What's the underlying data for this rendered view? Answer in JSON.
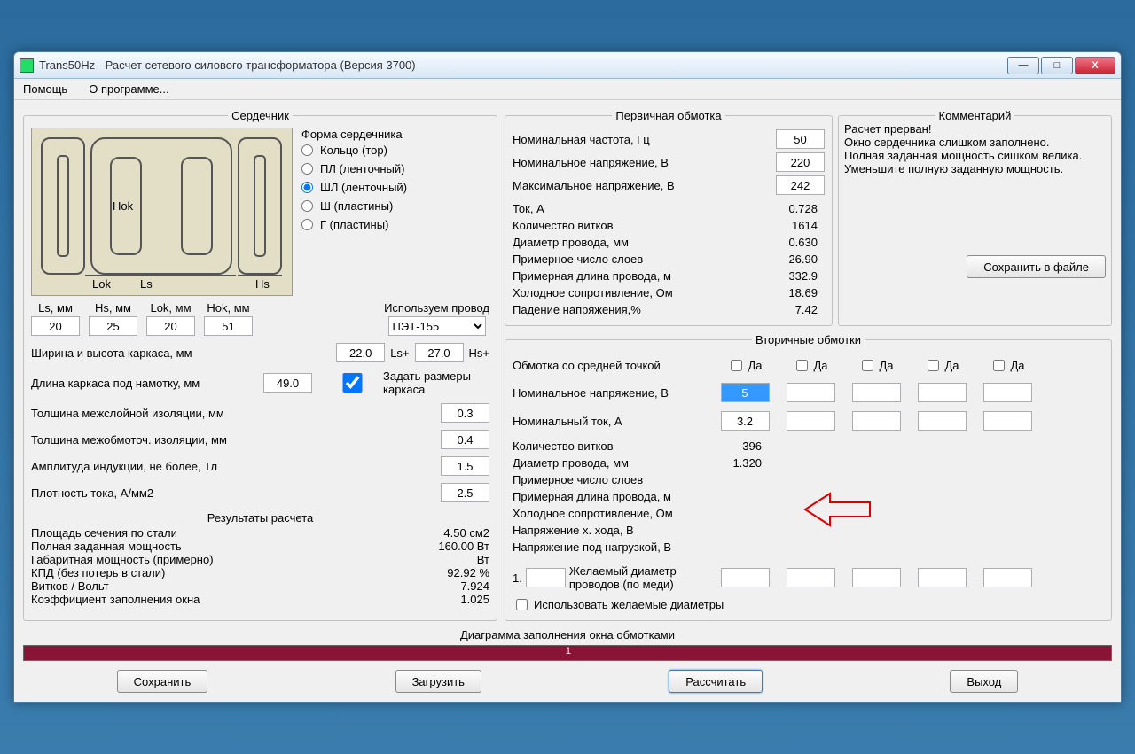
{
  "window_title": "Trans50Hz - Расчет сетевого силового трансформатора (Версия 3700)",
  "menu": {
    "help": "Помощь",
    "about": "О программе..."
  },
  "core": {
    "legend": "Сердечник",
    "form_label": "Форма сердечника",
    "forms": [
      {
        "label": "Кольцо (тор)",
        "sel": false
      },
      {
        "label": "ПЛ (ленточный)",
        "sel": false
      },
      {
        "label": "ШЛ (ленточный)",
        "sel": true
      },
      {
        "label": "Ш  (пластины)",
        "sel": false
      },
      {
        "label": "Г (пластины)",
        "sel": false
      }
    ],
    "diagram_labels": {
      "hok": "Hok",
      "lok": "Lok",
      "ls": "Ls",
      "hs": "Hs"
    },
    "dims": {
      "ls": {
        "label": "Ls, мм",
        "val": "20"
      },
      "hs": {
        "label": "Hs, мм",
        "val": "25"
      },
      "lok": {
        "label": "Lok, мм",
        "val": "20"
      },
      "hok": {
        "label": "Hok, мм",
        "val": "51"
      }
    },
    "wire_label": "Используем провод",
    "wire_value": "ПЭТ-155",
    "params": {
      "frame_wh": {
        "label": "Ширина и высота каркаса, мм",
        "v1": "22.0",
        "suf1": "Ls+",
        "v2": "27.0",
        "suf2": "Hs+"
      },
      "frame_len": {
        "label": "Длина каркаса под намотку, мм",
        "val": "49.0"
      },
      "set_frame": {
        "label": "Задать размеры каркаса",
        "checked": true
      },
      "interlayer": {
        "label": "Толщина межслойной изоляции, мм",
        "val": "0.3"
      },
      "interwind": {
        "label": "Толщина межобмоточ. изоляции, мм",
        "val": "0.4"
      },
      "induction": {
        "label": "Амплитуда индукции, не более, Тл",
        "val": "1.5"
      },
      "j": {
        "label": "Плотность тока, А/мм2",
        "val": "2.5"
      }
    },
    "results_title": "Результаты расчета",
    "results": [
      {
        "l": "Площадь сечения по стали",
        "v": "4.50 см2"
      },
      {
        "l": "Полная заданная мощность",
        "v": "160.00 Вт"
      },
      {
        "l": "Габаритная мощность (примерно)",
        "v": "Вт"
      },
      {
        "l": "КПД (без потерь в стали)",
        "v": "92.92 %"
      },
      {
        "l": "Витков / Вольт",
        "v": "7.924"
      },
      {
        "l": "Коэффициент заполнения окна",
        "v": "1.025"
      }
    ]
  },
  "primary": {
    "legend": "Первичная обмотка",
    "rows_in": [
      {
        "l": "Номинальная частота, Гц",
        "v": "50"
      },
      {
        "l": "Номинальное напряжение, В",
        "v": "220"
      },
      {
        "l": "Максимальное напряжение, В",
        "v": "242"
      }
    ],
    "rows_out": [
      {
        "l": "Ток, А",
        "v": "0.728"
      },
      {
        "l": "Количество витков",
        "v": "1614"
      },
      {
        "l": "Диаметр провода, мм",
        "v": "0.630"
      },
      {
        "l": "Примерное число слоев",
        "v": "26.90"
      },
      {
        "l": "Примерная длина провода, м",
        "v": "332.9"
      },
      {
        "l": "Холодное сопротивление, Ом",
        "v": "18.69"
      },
      {
        "l": "Падение напряжения,%",
        "v": "7.42"
      }
    ]
  },
  "comment": {
    "legend": "Комментарий",
    "text": "Расчет прерван!\nОкно сердечника слишком заполнено.\nПолная заданная мощность сишком велика.\nУменьшите полную заданную мощность.",
    "save_btn": "Сохранить в файле"
  },
  "secondary": {
    "legend": "Вторичные обмотки",
    "midtap": "Обмотка со средней точкой",
    "da": "Да",
    "nom_v": {
      "label": "Номинальное напряжение, В",
      "val": "5"
    },
    "nom_i": {
      "label": "Номинальный ток, А",
      "val": "3.2"
    },
    "out_rows": [
      {
        "l": "Количество витков",
        "v": "396"
      },
      {
        "l": "Диаметр провода, мм",
        "v": "1.320"
      },
      {
        "l": "Примерное число слоев",
        "v": ""
      },
      {
        "l": "Примерная длина провода, м",
        "v": ""
      },
      {
        "l": "Холодное сопротивление, Ом",
        "v": ""
      },
      {
        "l": "Напряжение х. хода, В",
        "v": ""
      },
      {
        "l": "Напряжение под нагрузкой, В",
        "v": ""
      }
    ],
    "desired_num": "1.",
    "desired": "Желаемый диаметр проводов  (по меди)",
    "use_desired": "Использовать желаемые диаметры"
  },
  "diag_label": "Диаграмма заполнения окна обмотками",
  "diag_num": "1",
  "buttons": {
    "save": "Сохранить",
    "load": "Загрузить",
    "calc": "Рассчитать",
    "exit": "Выход"
  }
}
